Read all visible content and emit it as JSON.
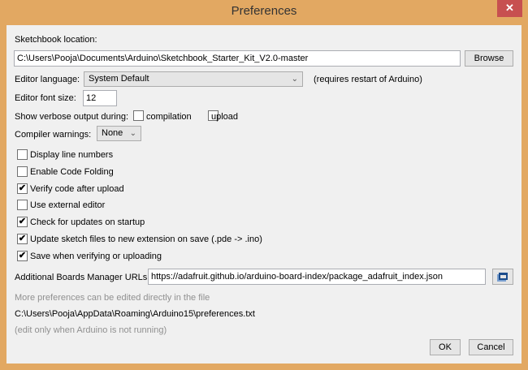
{
  "window": {
    "title": "Preferences",
    "close": "✕"
  },
  "sketchbook": {
    "label": "Sketchbook location:",
    "value": "C:\\Users\\Pooja\\Documents\\Arduino\\Sketchbook_Starter_Kit_V2.0-master",
    "browse": "Browse"
  },
  "language": {
    "label": "Editor language:",
    "value": "System Default",
    "note": "(requires restart of Arduino)"
  },
  "font_size": {
    "label": "Editor font size:",
    "value": "12"
  },
  "verbose": {
    "label": "Show verbose output during:",
    "compilation": "compilation",
    "upload": "upload",
    "compilation_checked": false,
    "upload_checked": false
  },
  "warnings": {
    "label": "Compiler warnings:",
    "value": "None"
  },
  "options": [
    {
      "label": "Display line numbers",
      "checked": false
    },
    {
      "label": "Enable Code Folding",
      "checked": false
    },
    {
      "label": "Verify code after upload",
      "checked": true
    },
    {
      "label": "Use external editor",
      "checked": false
    },
    {
      "label": "Check for updates on startup",
      "checked": true
    },
    {
      "label": "Update sketch files to new extension on save (.pde -> .ino)",
      "checked": true
    },
    {
      "label": "Save when verifying or uploading",
      "checked": true
    }
  ],
  "boards": {
    "label": "Additional Boards Manager URLs:",
    "value": "https://adafruit.github.io/arduino-board-index/package_adafruit_index.json"
  },
  "footer": {
    "more": "More preferences can be edited directly in the file",
    "path": "C:\\Users\\Pooja\\AppData\\Roaming\\Arduino15\\preferences.txt",
    "edit_note": "(edit only when Arduino is not running)",
    "ok": "OK",
    "cancel": "Cancel"
  }
}
